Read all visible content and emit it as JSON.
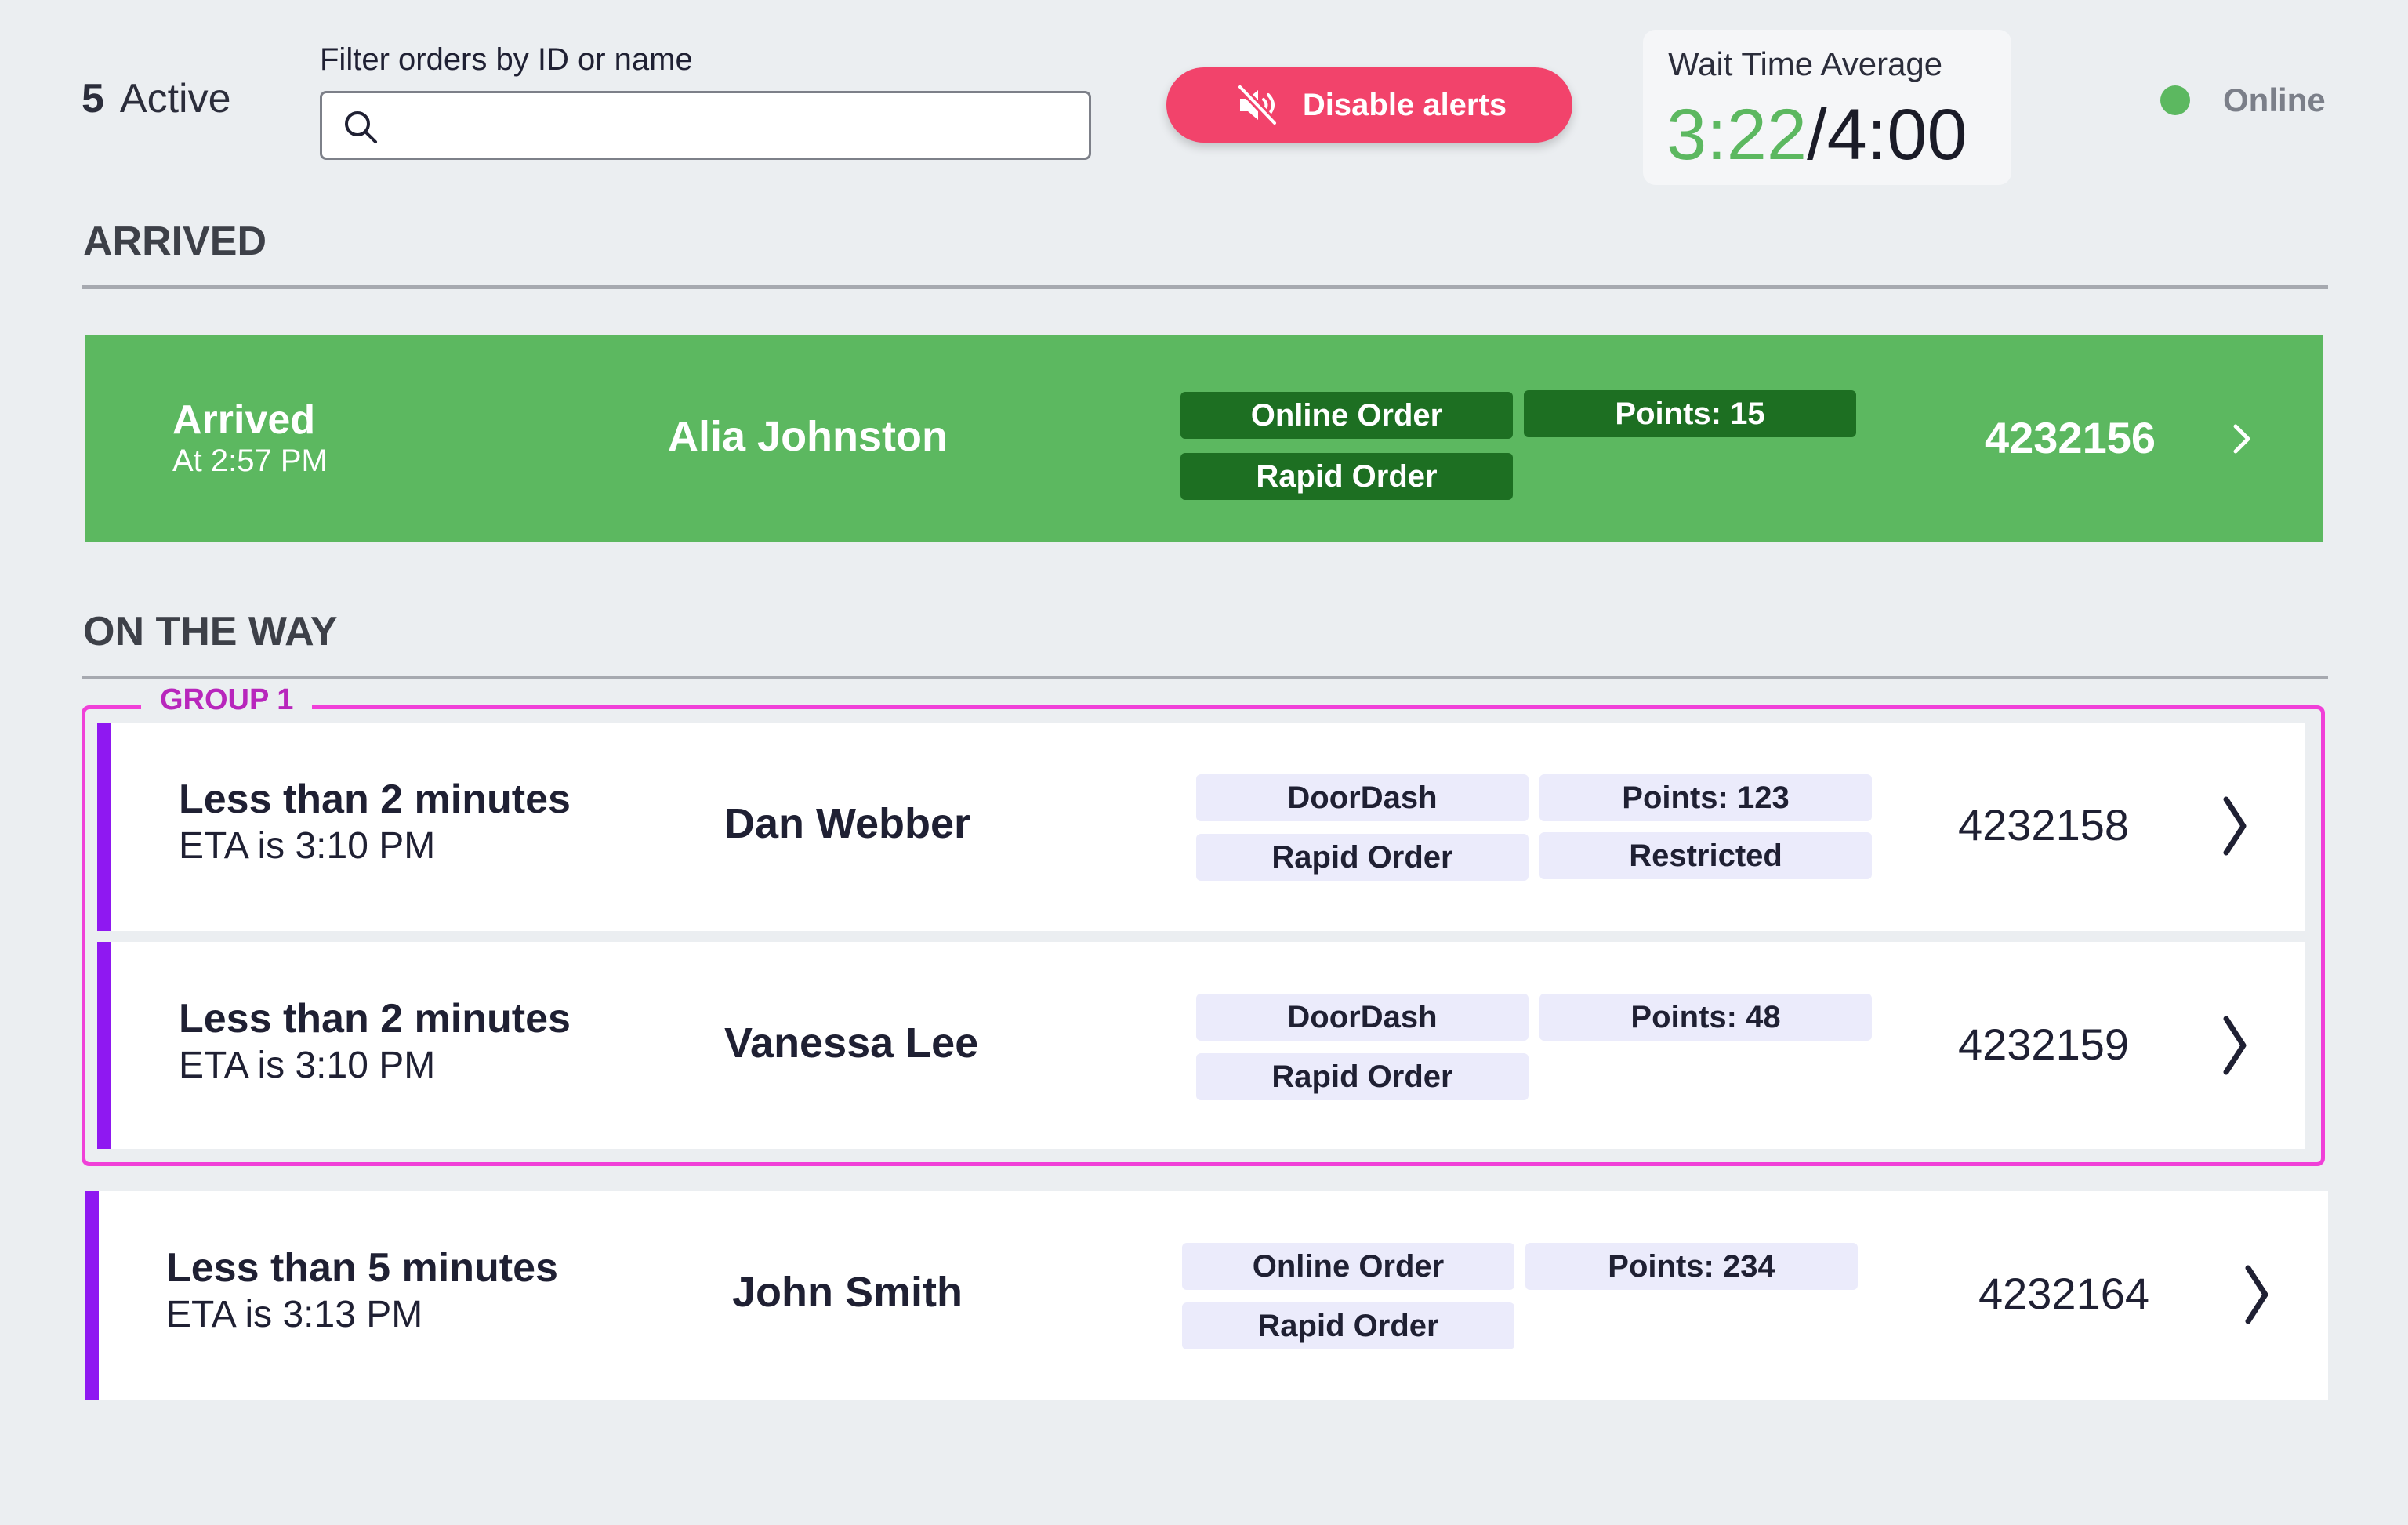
{
  "header": {
    "active_count": "5",
    "active_label": "Active",
    "filter_label": "Filter orders by ID or name",
    "search_value": "",
    "alert_button_label": "Disable alerts",
    "wait_time_label": "Wait Time Average",
    "wait_time_current": "3:22",
    "wait_time_separator": "/",
    "wait_time_target": "4:00",
    "status_label": "Online"
  },
  "colors": {
    "background": "#ebeef1",
    "arrived_green": "#5cb860",
    "arrived_tag": "#1d6f22",
    "alert_pink": "#f2436b",
    "eta_bar_purple": "#8f18f1",
    "group_border": "#f040d8",
    "group_label": "#b826bc",
    "tag_bg": "#ebebfb",
    "online_dot": "#5cb860"
  },
  "sections": {
    "arrived_title": "ARRIVED",
    "on_the_way_title": "ON THE WAY"
  },
  "arrived_orders": [
    {
      "status": "Arrived",
      "time": "At 2:57 PM",
      "name": "Alia Johnston",
      "tags": [
        "Online Order",
        "Points: 15",
        "Rapid Order"
      ],
      "order_id": "4232156"
    }
  ],
  "group": {
    "label": "GROUP 1",
    "orders": [
      {
        "eta_label": "Less than 2 minutes",
        "eta_time": "ETA is 3:10 PM",
        "name": "Dan Webber",
        "tags": [
          "DoorDash",
          "Points: 123",
          "Rapid Order",
          "Restricted"
        ],
        "order_id": "4232158"
      },
      {
        "eta_label": "Less than 2 minutes",
        "eta_time": "ETA is 3:10 PM",
        "name": "Vanessa Lee",
        "tags": [
          "DoorDash",
          "Points: 48",
          "Rapid Order"
        ],
        "order_id": "4232159"
      }
    ]
  },
  "ungrouped_orders": [
    {
      "eta_label": "Less than 5 minutes",
      "eta_time": "ETA is 3:13 PM",
      "name": "John Smith",
      "tags": [
        "Online Order",
        "Points: 234",
        "Rapid Order"
      ],
      "order_id": "4232164"
    }
  ],
  "icons": {
    "search": "search-icon",
    "mute": "speaker-muted-icon",
    "chevron": "chevron-right-icon"
  }
}
